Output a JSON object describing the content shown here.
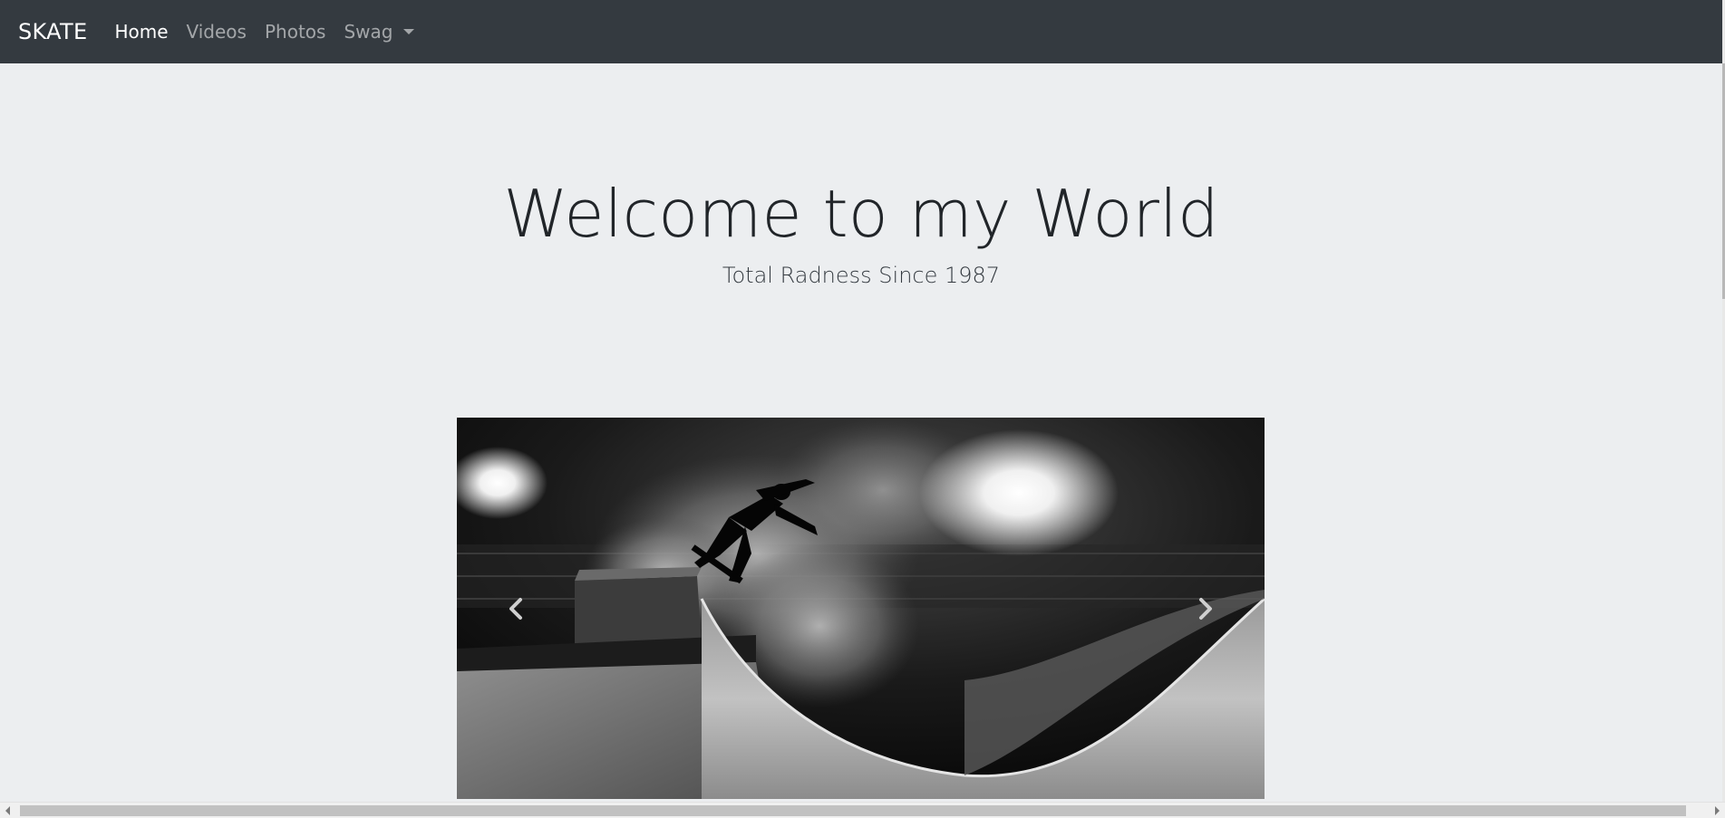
{
  "navbar": {
    "brand": "SKATE",
    "links": [
      "Home",
      "Videos",
      "Photos",
      "Swag"
    ],
    "active": "Home"
  },
  "hero": {
    "title": "Welcome to my World",
    "subtitle": "Total Radness Since 1987"
  },
  "carousel": {
    "controls": {
      "prev_icon": "chevron-left-icon",
      "next_icon": "chevron-right-icon"
    }
  },
  "colors": {
    "navbar_bg": "#343a40",
    "page_bg": "#eceef0",
    "nav_active": "#ffffff",
    "nav_muted": "#9ba0a5"
  }
}
